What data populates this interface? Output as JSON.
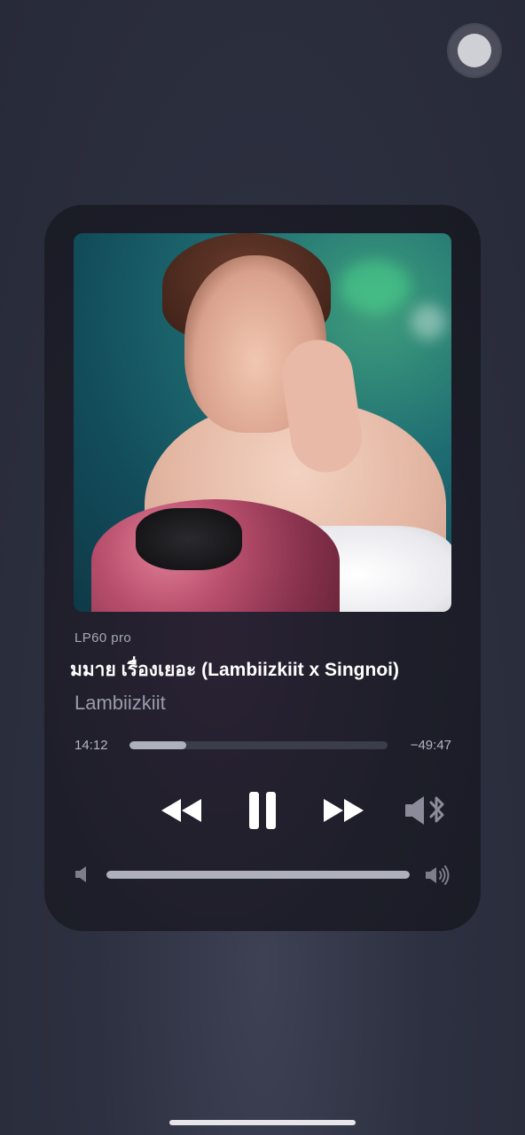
{
  "player": {
    "source": "LP60 pro",
    "title": "มมาย เรื่องเยอะ (Lambiizkiit x Singnoi)",
    "artist": "Lambiizkiit",
    "elapsed": "14:12",
    "remaining": "−49:47",
    "progress": 0.22,
    "volume": 1.0
  },
  "icons": {
    "rewind": "rewind-icon",
    "pause": "pause-icon",
    "forward": "fast-forward-icon",
    "output": "speaker-bluetooth-icon",
    "volume_low": "volume-low-icon",
    "volume_high": "volume-high-icon"
  },
  "colors": {
    "accent": "#aeb0bc",
    "track": "#3b3d4a",
    "text_primary": "#ffffff",
    "text_secondary": "#9a9cab"
  }
}
